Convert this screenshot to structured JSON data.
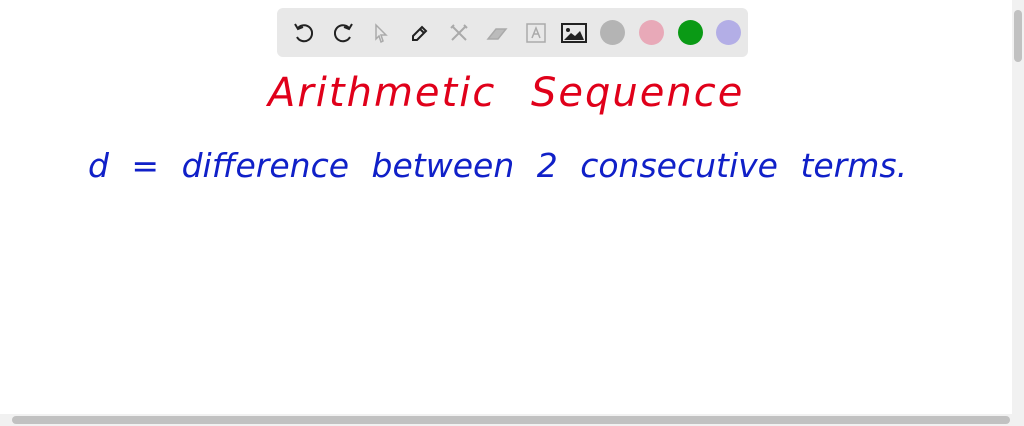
{
  "toolbar": {
    "tools": [
      "undo-icon",
      "redo-icon",
      "select-icon",
      "pen-icon",
      "tools-icon",
      "eraser-icon",
      "text-icon",
      "image-icon"
    ],
    "colors": [
      "#b4b4b4",
      "#e8a9b8",
      "#0a9a15",
      "#b3aee6"
    ]
  },
  "canvas": {
    "title": "Arithmetic Sequence",
    "line1": "d = difference between 2 consecutive terms.",
    "title_color": "#e0001a",
    "line_color": "#1020c8"
  }
}
